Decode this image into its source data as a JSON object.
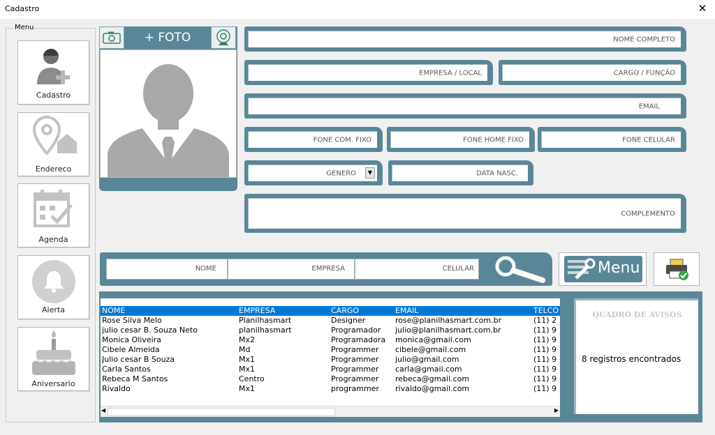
{
  "window": {
    "title": "Cadastro",
    "close_glyph": "✕"
  },
  "menu": {
    "legend": "Menu",
    "items": [
      {
        "label": "Cadastro",
        "icon": "user-add-icon"
      },
      {
        "label": "Endereco",
        "icon": "location-home-icon"
      },
      {
        "label": "Agenda",
        "icon": "calendar-check-icon"
      },
      {
        "label": "Alerta",
        "icon": "bell-icon"
      },
      {
        "label": "Aniversario",
        "icon": "birthday-cake-icon"
      }
    ]
  },
  "photo": {
    "add_label": "+ FOTO",
    "left_icon": "camera-icon",
    "right_icon": "webcam-icon"
  },
  "form": {
    "nome": "NOME COMPLETO",
    "empresa": "EMPRESA / LOCAL",
    "cargo": "CARGO / FUNÇÃO",
    "email": "EMAIL",
    "fone_com": "FONE COM. FIXO",
    "fone_home": "FONE HOME FIXO",
    "fone_cel": "FONE CELULAR",
    "genero": "GENERO",
    "data_nasc": "DATA NASC.",
    "complemento": "COMPLEMENTO"
  },
  "search": {
    "nome": "NOME",
    "empresa": "EMPRESA",
    "celular": "CELULAR"
  },
  "menu_button": {
    "label": "Menu"
  },
  "table": {
    "columns": [
      "NOME",
      "EMPRESA",
      "CARGO",
      "EMAIL",
      "TELCO"
    ],
    "rows": [
      [
        "Rose Silva Melo",
        "Planilhasmart",
        "Designer",
        "rose@planilhasmart.com.br",
        "(11) 2"
      ],
      [
        "julio cesar B. Souza Neto",
        "planilhasmart",
        "Programador",
        "julio@planilhasmart.com.br",
        "(11) 9"
      ],
      [
        "Monica Oliveira",
        "Mx2",
        "Programadora",
        "monica@gmail.com",
        "(11) 9"
      ],
      [
        "Cibele Almeida",
        "Md",
        "Programmer",
        "cibele@gmail.com",
        "(11) 9"
      ],
      [
        "Julio cesar B Souza",
        "Mx1",
        "Programmer",
        "julio@gmail.com",
        "(11) 9"
      ],
      [
        "Carla Santos",
        "Mx1",
        "Programmer",
        "carla@gmail.com",
        "(11) 9"
      ],
      [
        "Rebeca M Santos",
        "Centro",
        "Programmer",
        "rebeca@gmail.com",
        "(11) 9"
      ],
      [
        "Rivaldo",
        "Mx1",
        "programmer",
        "rivaldo@gmail.com",
        "(11) 9"
      ]
    ]
  },
  "notice": {
    "title": "QUADRO DE AVISOS",
    "message": "8 registros encontrados"
  },
  "colors": {
    "accent": "#5a8798",
    "selection": "#0078d7"
  }
}
